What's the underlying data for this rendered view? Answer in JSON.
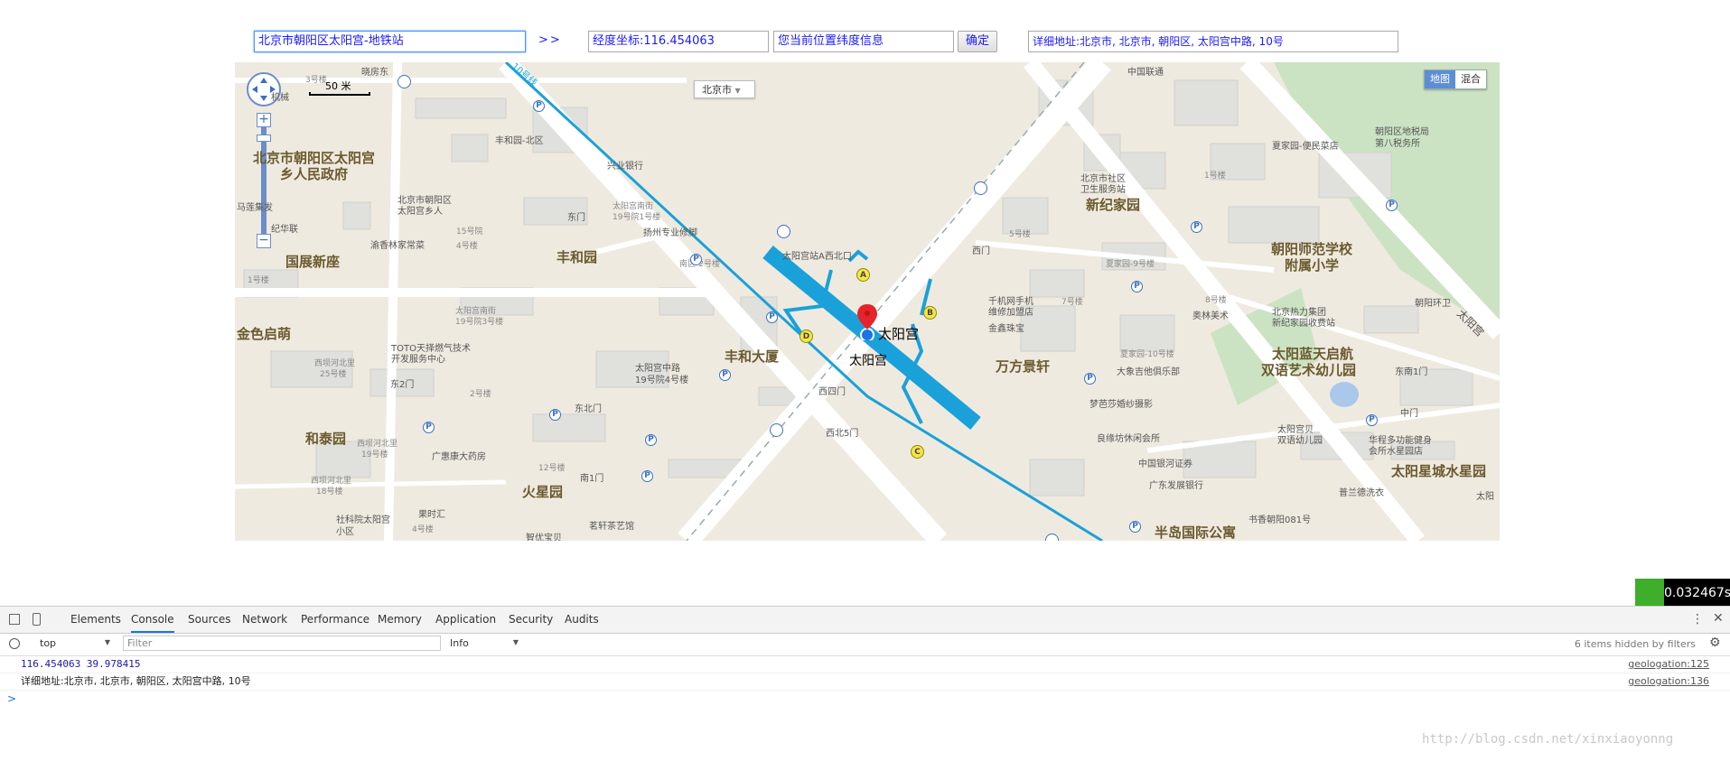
{
  "top_inputs": {
    "search_value": "北京市朝阳区太阳宫-地铁站",
    "arrow_label": ">>",
    "longitude_value": "经度坐标:116.454063",
    "latitude_placeholder": "您当前位置纬度信息",
    "ok_label": "确定",
    "address_value": "详细地址:北京市, 北京市, 朝阳区, 太阳宫中路, 10号"
  },
  "map": {
    "scale_label": "50 米",
    "city_label": "北京市",
    "maptype": [
      "地图",
      "混合"
    ],
    "line_label": "10号线",
    "colors": {
      "subway": "#1aa1d9",
      "land": "#efeae0",
      "road": "#ffffff",
      "park": "#cbe3c3",
      "block": "#e0e0dc"
    },
    "labels_big": [
      {
        "t": "北京市朝阳区太阳宫"
      },
      {
        "t": "乡人民政府"
      },
      {
        "t": "国展新座"
      },
      {
        "t": "金色启萌"
      },
      {
        "t": "和泰园"
      },
      {
        "t": "丰和园"
      },
      {
        "t": "丰和大厦"
      },
      {
        "t": "火星园"
      },
      {
        "t": "万方景轩"
      },
      {
        "t": "新纪家园"
      },
      {
        "t": "朝阳师范学校"
      },
      {
        "t": "附属小学"
      },
      {
        "t": "太阳蓝天启航"
      },
      {
        "t": "双语艺术幼儿园"
      },
      {
        "t": "太阳星城水星园"
      },
      {
        "t": "半岛国际公寓"
      }
    ],
    "labels_small": [
      "3号楼",
      "晓房东",
      "北京市朝阳区",
      "太阳宫乡人",
      "渝香林家常菜",
      "15号院",
      "4号楼",
      "兴业银行",
      "丰和园-北区",
      "东门",
      "太阳宫南街",
      "19号院1号楼",
      "扬州专业修脚",
      "南区-2号楼",
      "太阳宫南街",
      "19号院3号楼",
      "TOTO天择燃气技术",
      "开发服务中心",
      "西坝河北里",
      "25号楼",
      "东2门",
      "2号楼",
      "东北门",
      "西坝河北里",
      "19号楼",
      "广惠康大药房",
      "西坝河北里",
      "18号楼",
      "社科院太阳宫",
      "小区",
      "果时汇",
      "12号楼",
      "南1门",
      "茗轩茶艺馆",
      "智优宝贝",
      "4号楼",
      "太阳宫中路",
      "19号院4号楼",
      "西四门",
      "西北5门",
      "太阳宫站A西北口",
      "千机网手机",
      "维修加盟店",
      "金鑫珠宝",
      "7号楼",
      "夏家园-9号楼",
      "5号楼",
      "西门",
      "北京市社区",
      "卫生服务站",
      "1号楼",
      "中国联通",
      "夏家园-便民菜店",
      "朝阳区地税局",
      "第八税务所",
      "8号楼",
      "奥林美术",
      "北京热力集团",
      "新纪家园收费站",
      "朝阳环卫",
      "东南1门",
      "中门",
      "太阳宫贝",
      "双语幼儿园",
      "华程多功能健身",
      "会所水星园店",
      "梦芭莎婚纱摄影",
      "大象吉他俱乐部",
      "夏家园-10号楼",
      "良缘坊休闲会所",
      "中国银河证券",
      "广东发展银行",
      "普兰德洗衣",
      "书香朝阳081号",
      "太阳宫",
      "马莲集发",
      "纪华联",
      "机械",
      "1号楼",
      "太阳"
    ],
    "station_label": "太阳宫",
    "station_label2": "太阳宫",
    "exits": [
      "A",
      "B",
      "C",
      "D"
    ]
  },
  "timer": {
    "value": "0.032467s"
  },
  "devtools": {
    "tabs": [
      "Elements",
      "Console",
      "Sources",
      "Network",
      "Performance",
      "Memory",
      "Application",
      "Security",
      "Audits"
    ],
    "active_tab": "Console",
    "context": "top",
    "filter_placeholder": "Filter",
    "level": "Info",
    "hidden_info": "6 items hidden by filters",
    "lines": [
      {
        "text": "116.454063 39.978415",
        "source": "geologation:125"
      },
      {
        "text": "详细地址:北京市, 北京市, 朝阳区, 太阳宫中路, 10号",
        "source": "geologation:136"
      }
    ],
    "prompt": ">"
  },
  "watermark": "http://blog.csdn.net/xinxiaoyonng"
}
